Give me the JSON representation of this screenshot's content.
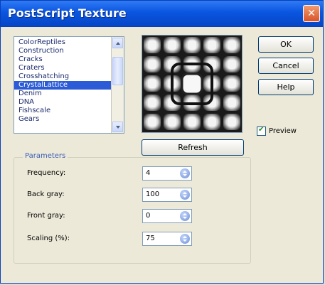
{
  "window": {
    "title": "PostScript Texture"
  },
  "texture_list": {
    "items": [
      "ColorReptiles",
      "Construction",
      "Cracks",
      "Craters",
      "Crosshatching",
      "CrystalLattice",
      "Denim",
      "DNA",
      "Fishscale",
      "Gears"
    ],
    "selected": "CrystalLattice"
  },
  "buttons": {
    "refresh": "Refresh",
    "ok": "OK",
    "cancel": "Cancel",
    "help": "Help"
  },
  "preview": {
    "label": "Preview",
    "checked": true
  },
  "parameters": {
    "title": "Parameters",
    "frequency": {
      "label": "Frequency:",
      "value": "4"
    },
    "back_gray": {
      "label": "Back gray:",
      "value": "100"
    },
    "front_gray": {
      "label": "Front gray:",
      "value": "0"
    },
    "scaling": {
      "label": "Scaling (%):",
      "value": "75"
    }
  }
}
